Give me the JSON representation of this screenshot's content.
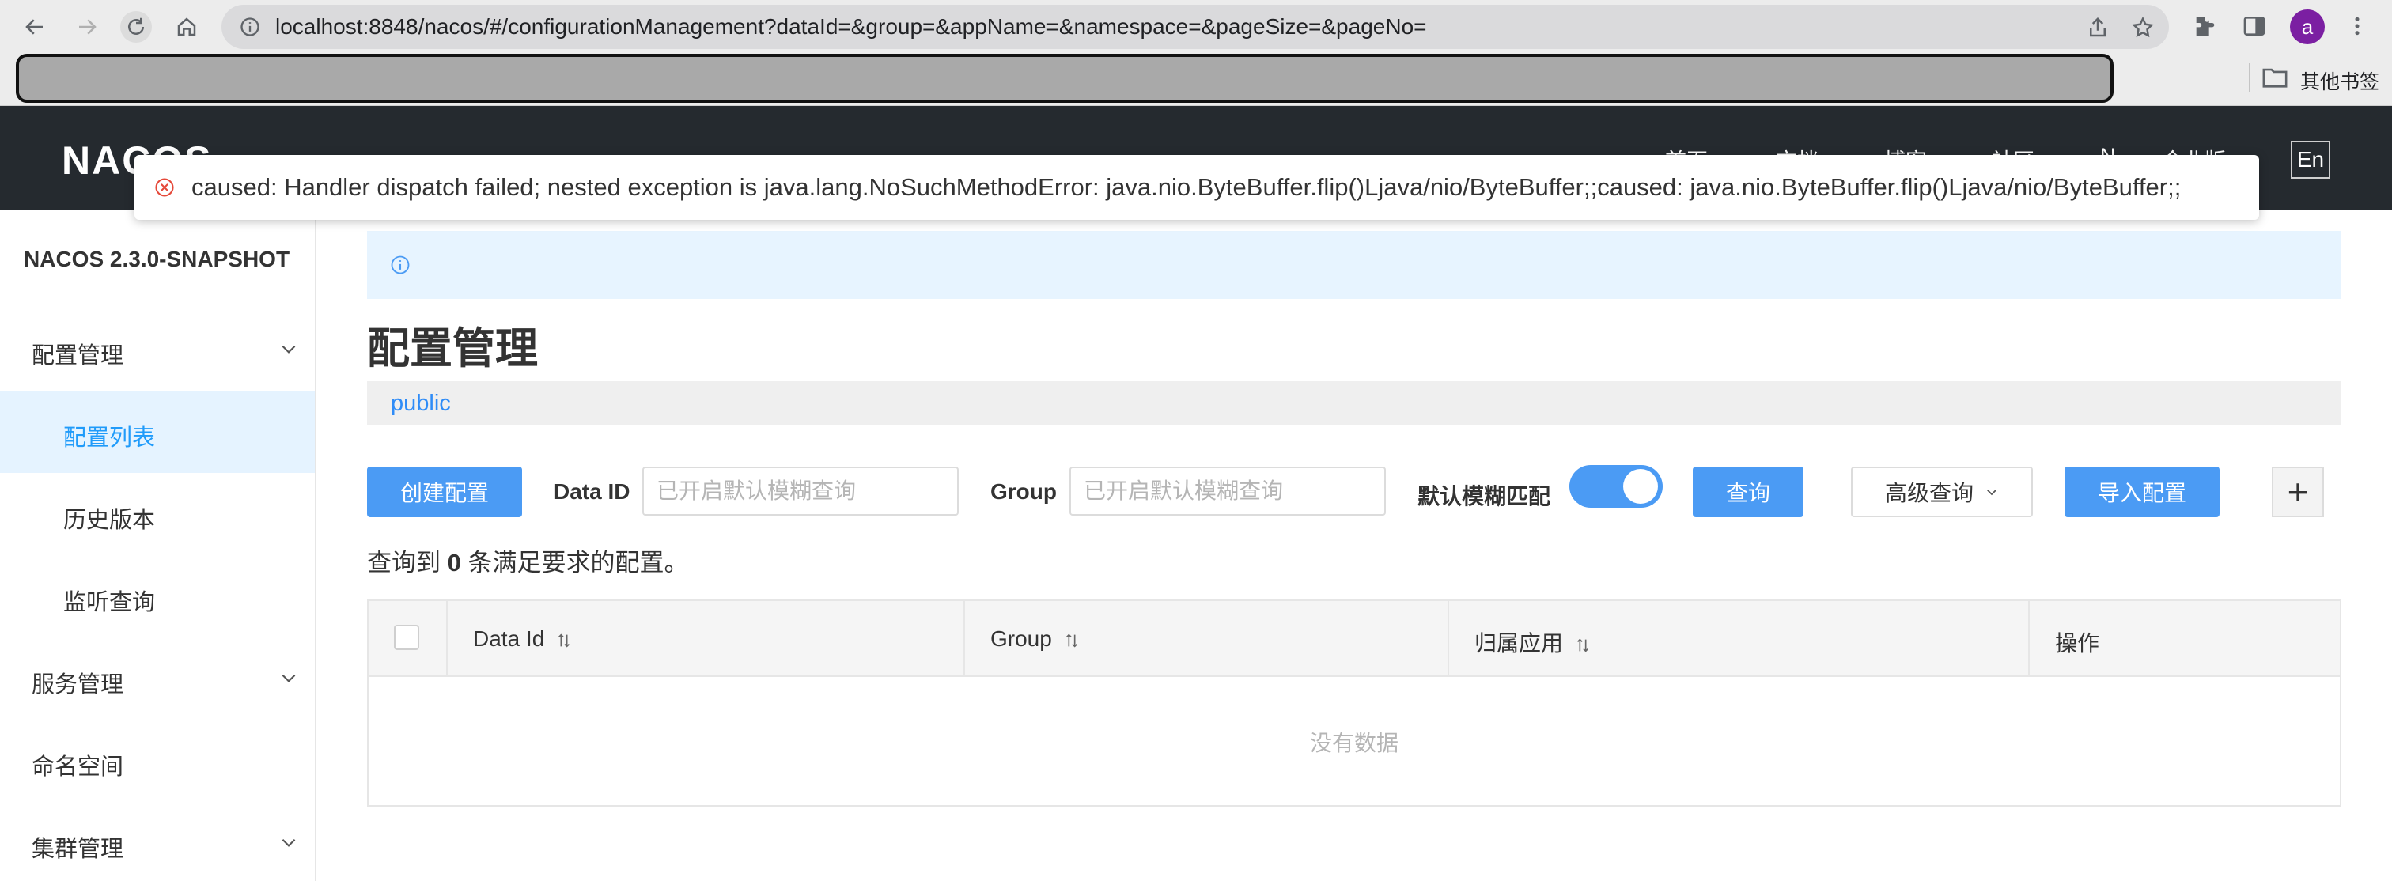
{
  "browser": {
    "url": "localhost:8848/nacos/#/configurationManagement?dataId=&group=&appName=&namespace=&pageSize=&pageNo=",
    "avatar_letter": "a",
    "bookmark_folder": "其他书签"
  },
  "header": {
    "logo": "NACOS",
    "menu": [
      "首页",
      "文档",
      "博客",
      "社区",
      "N",
      "企业版"
    ],
    "lang": "En"
  },
  "toast": {
    "message": "caused: Handler dispatch failed; nested exception is java.lang.NoSuchMethodError: java.nio.ByteBuffer.flip()Ljava/nio/ByteBuffer;;caused: java.nio.ByteBuffer.flip()Ljava/nio/ByteBuffer;;"
  },
  "sidebar": {
    "version": "NACOS 2.3.0-SNAPSHOT",
    "items": [
      {
        "label": "配置管理"
      },
      {
        "label": "配置列表"
      },
      {
        "label": "历史版本"
      },
      {
        "label": "监听查询"
      },
      {
        "label": "服务管理"
      },
      {
        "label": "命名空间"
      },
      {
        "label": "集群管理"
      }
    ]
  },
  "main": {
    "title": "配置管理",
    "namespace": "public",
    "create_button": "创建配置",
    "data_id_label": "Data ID",
    "data_id_placeholder": "已开启默认模糊查询",
    "group_label": "Group",
    "group_placeholder": "已开启默认模糊查询",
    "fuzzy_label": "默认模糊匹配",
    "fuzzy_enabled": true,
    "search_button": "查询",
    "advanced_button": "高级查询",
    "import_button": "导入配置",
    "plus_button": "+",
    "result_prefix": "查询到",
    "result_count": "0",
    "result_suffix": "条满足要求的配置。"
  },
  "table": {
    "columns": [
      "Data Id",
      "Group",
      "归属应用",
      "操作"
    ],
    "empty_text": "没有数据"
  },
  "colors": {
    "primary": "#4b9bf4",
    "header_bg": "#252a2f",
    "active_bg": "#e5f3ff",
    "error": "#e5493a"
  }
}
